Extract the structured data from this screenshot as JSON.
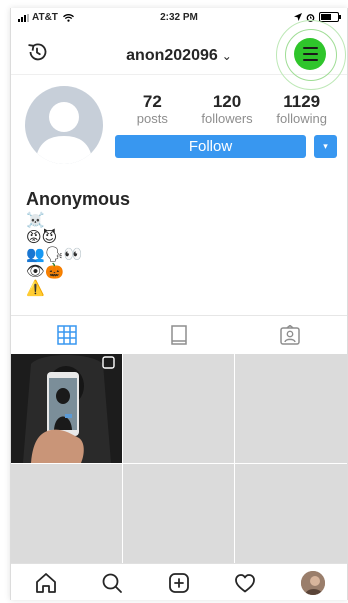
{
  "status_bar": {
    "carrier": "AT&T",
    "time": "2:32 PM"
  },
  "header": {
    "username": "anon202096",
    "username_chevron": "⌄"
  },
  "profile": {
    "stats": [
      {
        "value": "72",
        "label": "posts"
      },
      {
        "value": "120",
        "label": "followers"
      },
      {
        "value": "1129",
        "label": "following"
      }
    ],
    "follow_label": "Follow",
    "dropdown_label": "▾",
    "display_name": "Anonymous",
    "bio_lines": [
      "☠️",
      "😡😈",
      "👥🗣👀",
      "👁🎃",
      "⚠️"
    ]
  },
  "colors": {
    "accent": "#3897f0",
    "menu_button": "#2fc52b",
    "grid_placeholder": "#dbdbdb"
  },
  "icons": {
    "history": "history-icon",
    "menu": "hamburger-icon",
    "grid_tab": "grid-icon",
    "list_tab": "list-icon",
    "tagged_tab": "tagged-icon",
    "home": "home-icon",
    "search": "search-icon",
    "add": "plus-square-icon",
    "activity": "heart-icon",
    "profile": "profile-avatar-icon"
  }
}
